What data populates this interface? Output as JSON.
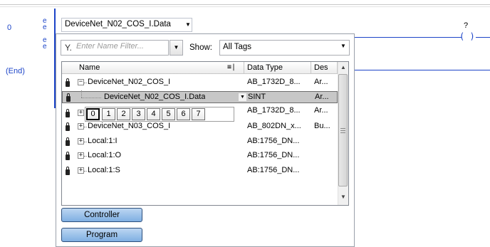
{
  "ladder": {
    "rung_numbers": [
      "0",
      "(End)"
    ],
    "rail_markers": [
      "e",
      "e",
      "e",
      "e"
    ],
    "coil_symbol": "( )",
    "coil_tag": "?"
  },
  "tag_field": {
    "value": "DeviceNet_N02_COS_I.Data"
  },
  "tag_browser": {
    "filter_placeholder": "Enter Name Filter...",
    "show_label": "Show:",
    "show_value": "All Tags",
    "columns": [
      "Name",
      "Data Type",
      "Des"
    ],
    "rows": [
      {
        "name": "DeviceNet_N02_COS_I",
        "expander": "−",
        "data_type": "AB_1732D_8...",
        "description": "Ar..."
      },
      {
        "name": "DeviceNet_N02_COS_I.Data",
        "expander": "",
        "data_type": "SINT",
        "description": "Ar..."
      },
      {
        "name": "",
        "expander": "+",
        "data_type": "AB_1732D_8...",
        "description": "Ar..."
      },
      {
        "name": "DeviceNet_N03_COS_I",
        "expander": "+",
        "data_type": "AB_802DN_x...",
        "description": "Bu..."
      },
      {
        "name": "Local:1:I",
        "expander": "+",
        "data_type": "AB:1756_DN...",
        "description": ""
      },
      {
        "name": "Local:1:O",
        "expander": "+",
        "data_type": "AB:1756_DN...",
        "description": ""
      },
      {
        "name": "Local:1:S",
        "expander": "+",
        "data_type": "AB:1756_DN...",
        "description": ""
      }
    ],
    "bit_options": [
      "0",
      "1",
      "2",
      "3",
      "4",
      "5",
      "6",
      "7"
    ],
    "selected_bit": "0",
    "buttons": {
      "controller": "Controller",
      "program": "Program"
    }
  },
  "colors": {
    "ladder_blue": "#1c44c8",
    "selected_row": "#c7c7c7",
    "button_gradient_top": "#bcd6f2",
    "button_gradient_bottom": "#7fafe2"
  }
}
